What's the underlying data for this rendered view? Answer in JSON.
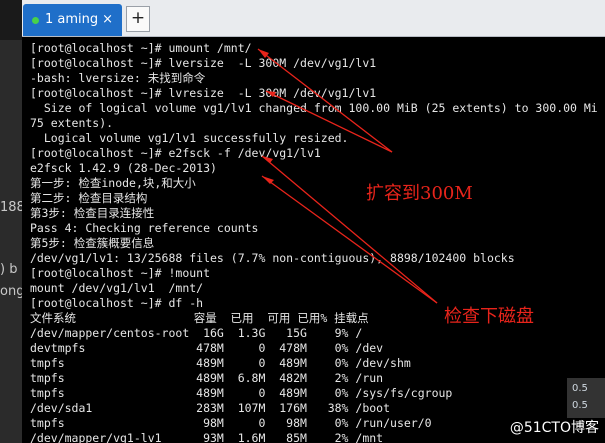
{
  "left_fragments": [
    "188",
    ") b",
    "ong"
  ],
  "tabs": [
    {
      "label": "1 aming",
      "close": "×"
    }
  ],
  "new_tab": "+",
  "terminal_lines": [
    "[root@localhost ~]# umount /mnt/",
    "[root@localhost ~]# lversize  -L 300M /dev/vg1/lv1",
    "-bash: lversize: 未找到命令",
    "[root@localhost ~]# lvresize  -L 300M /dev/vg1/lv1",
    "  Size of logical volume vg1/lv1 changed from 100.00 MiB (25 extents) to 300.00 Mi",
    "75 extents).",
    "  Logical volume vg1/lv1 successfully resized.",
    "[root@localhost ~]# e2fsck -f /dev/vg1/lv1",
    "e2fsck 1.42.9 (28-Dec-2013)",
    "第一步: 检查inode,块,和大小",
    "第二步: 检查目录结构",
    "第3步: 检查目录连接性",
    "Pass 4: Checking reference counts",
    "第5步: 检查簇概要信息",
    "/dev/vg1/lv1: 13/25688 files (7.7% non-contiguous), 8898/102400 blocks",
    "[root@localhost ~]# !mount",
    "mount /dev/vg1/lv1  /mnt/",
    "[root@localhost ~]# df -h",
    "文件系统                 容量  已用  可用 已用% 挂载点",
    "/dev/mapper/centos-root  16G  1.3G   15G    9% /",
    "devtmpfs                478M     0  478M    0% /dev",
    "tmpfs                   489M     0  489M    0% /dev/shm",
    "tmpfs                   489M  6.8M  482M    2% /run",
    "tmpfs                   489M     0  489M    0% /sys/fs/cgroup",
    "/dev/sda1               283M  107M  176M   38% /boot",
    "tmpfs                    98M     0   98M    0% /run/user/0",
    "/dev/mapper/vg1-lv1      93M  1.6M   85M    2% /mnt"
  ],
  "annotations": [
    "扩容到300M",
    "检查下磁盘"
  ],
  "annotation_color": "#e8241b",
  "tray_items": [
    "0.5",
    "0.5"
  ],
  "watermark": "@51CTO博客"
}
